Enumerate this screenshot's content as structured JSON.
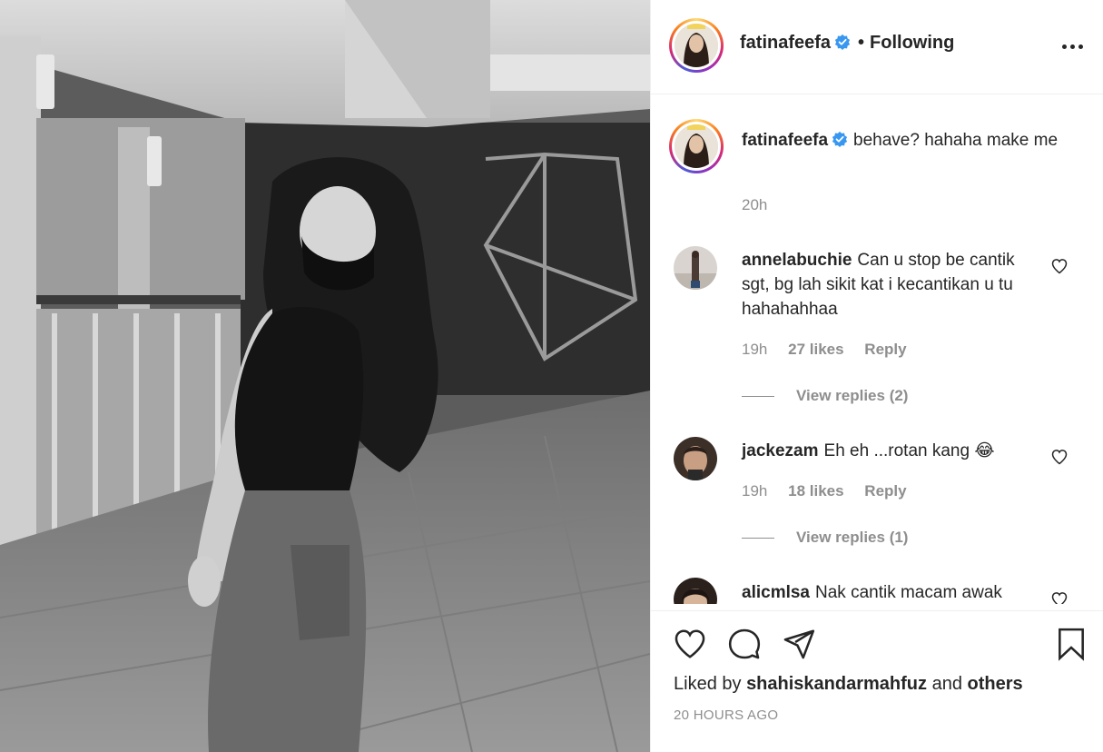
{
  "post": {
    "author": "fatinafeefa",
    "follow_separator": "•",
    "follow_status": "Following",
    "caption": "behave? hahaha make me",
    "caption_time": "20h"
  },
  "comments": [
    {
      "username": "annelabuchie",
      "text": "Can u stop be cantik sgt, bg lah sikit kat i kecantikan u tu hahahahhaa",
      "time": "19h",
      "likes": "27 likes",
      "reply_label": "Reply",
      "view_replies": "View replies (2)"
    },
    {
      "username": "jackezam",
      "text": "Eh eh ...rotan kang",
      "emoji": "😂",
      "time": "19h",
      "likes": "18 likes",
      "reply_label": "Reply",
      "view_replies": "View replies (1)"
    },
    {
      "username": "alicmlsa",
      "text": "Nak cantik macam awak"
    }
  ],
  "footer": {
    "liked_by_prefix": "Liked by",
    "liked_by_user": "shahiskandarmahfuz",
    "liked_by_and": "and",
    "liked_by_others": "others",
    "timestamp": "20 HOURS AGO"
  },
  "icons": {
    "verified": "verified-badge-icon",
    "more": "more-options-icon",
    "like": "heart-icon",
    "comment": "comment-bubble-icon",
    "share": "paper-plane-icon",
    "save": "bookmark-icon"
  },
  "colors": {
    "verified_blue": "#3897f0",
    "text_primary": "#262626",
    "text_secondary": "#8e8e8e",
    "divider": "#efefef"
  }
}
